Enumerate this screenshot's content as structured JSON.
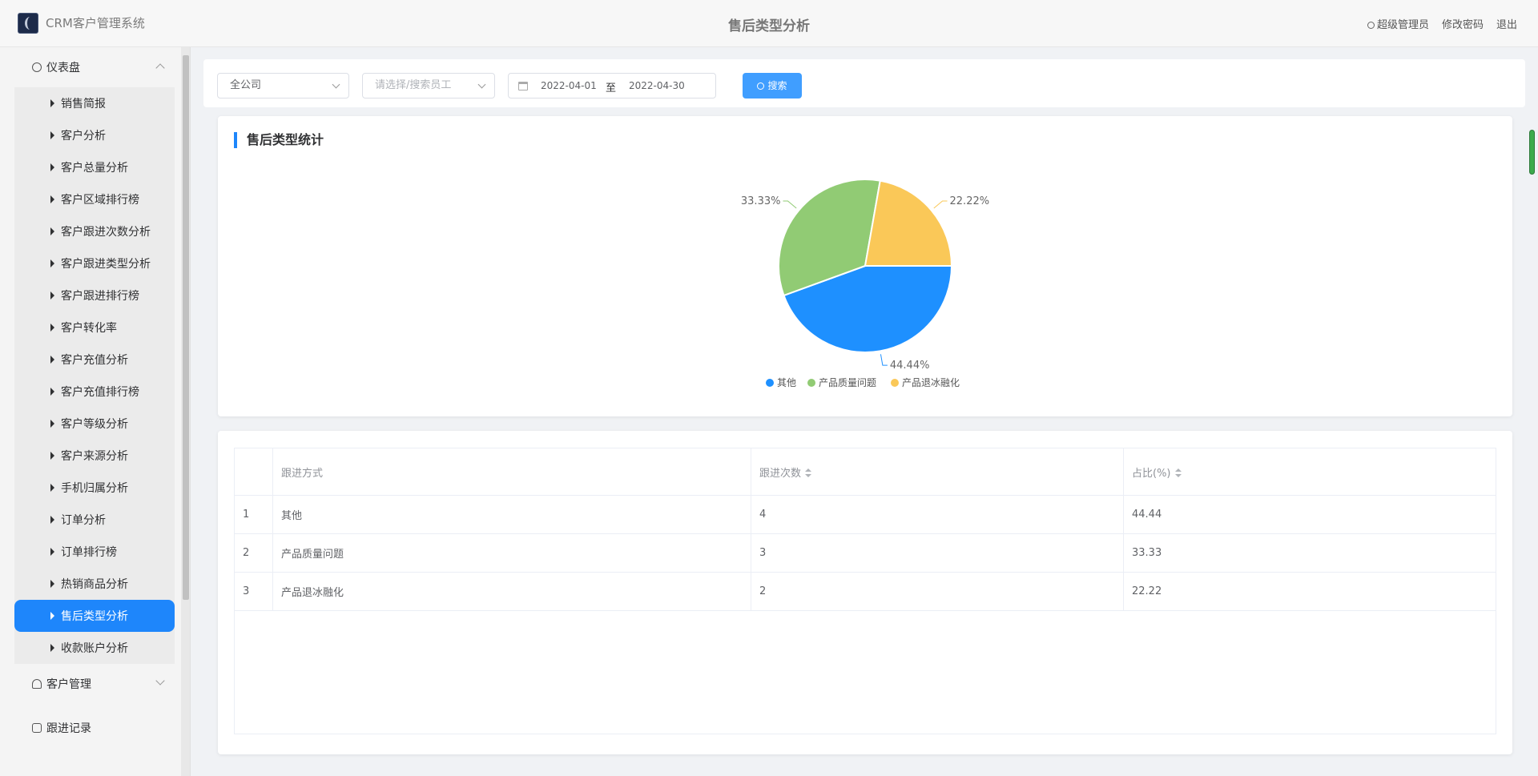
{
  "header": {
    "app_title": "CRM客户管理系统",
    "page_title": "售后类型分析",
    "user_label": "超级管理员",
    "change_password": "修改密码",
    "logout": "退出"
  },
  "sidebar": {
    "dashboard": "仪表盘",
    "items": [
      "销售简报",
      "客户分析",
      "客户总量分析",
      "客户区域排行榜",
      "客户跟进次数分析",
      "客户跟进类型分析",
      "客户跟进排行榜",
      "客户转化率",
      "客户充值分析",
      "客户充值排行榜",
      "客户等级分析",
      "客户来源分析",
      "手机归属分析",
      "订单分析",
      "订单排行榜",
      "热销商品分析",
      "售后类型分析",
      "收款账户分析"
    ],
    "active_index": 16,
    "customer_mgmt": "客户管理",
    "followup": "跟进记录"
  },
  "filters": {
    "company": "全公司",
    "employee_placeholder": "请选择/搜索员工",
    "date_start": "2022-04-01",
    "date_sep": "至",
    "date_end": "2022-04-30",
    "search_label": "搜索"
  },
  "chart_card": {
    "title": "售后类型统计"
  },
  "chart_data": {
    "type": "pie",
    "title": "",
    "slices": [
      {
        "name": "其他",
        "value": 4,
        "label": "44.44%",
        "color": "#1e90ff"
      },
      {
        "name": "产品质量问题",
        "value": 3,
        "label": "33.33%",
        "color": "#91cb74"
      },
      {
        "name": "产品退冰融化",
        "value": 2,
        "label": "22.22%",
        "color": "#fac858"
      }
    ],
    "legend_position": "bottom"
  },
  "table": {
    "headers": [
      "",
      "跟进方式",
      "跟进次数",
      "占比(%)"
    ],
    "rows": [
      [
        "1",
        "其他",
        "4",
        "44.44"
      ],
      [
        "2",
        "产品质量问题",
        "3",
        "33.33"
      ],
      [
        "3",
        "产品退冰融化",
        "2",
        "22.22"
      ]
    ]
  }
}
